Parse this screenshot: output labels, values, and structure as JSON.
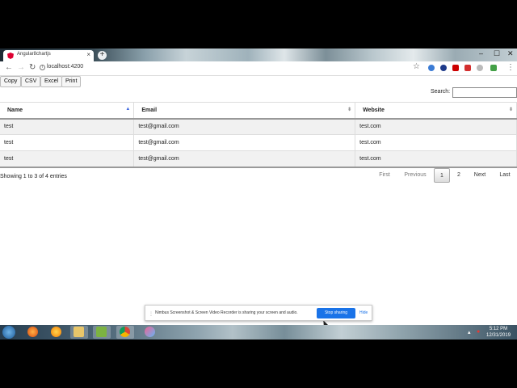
{
  "browser": {
    "tab_title": "Angular8chartjs",
    "tab_close": "×",
    "new_tab": "+",
    "url": "localhost:4200",
    "window_minimize": "–",
    "window_maximize": "☐",
    "window_close": "✕"
  },
  "toolbar": {
    "buttons": [
      "Copy",
      "CSV",
      "Excel",
      "Print"
    ],
    "search_label": "Search:",
    "search_value": ""
  },
  "table": {
    "headers": [
      "Name",
      "Email",
      "Website"
    ],
    "rows": [
      [
        "test",
        "test@gmail.com",
        "test.com"
      ],
      [
        "test",
        "test@gmail.com",
        "test.com"
      ],
      [
        "test",
        "test@gmail.com",
        "test.com"
      ]
    ]
  },
  "footer": {
    "info": "Showing 1 to 3 of 4 entries",
    "pager": {
      "first": "First",
      "previous": "Previous",
      "page1": "1",
      "page2": "2",
      "next": "Next",
      "last": "Last"
    }
  },
  "share_bar": {
    "dots": "⋮",
    "text": "Nimbus Screenshot & Screen Video Recorder is sharing your screen and audio.",
    "stop_label": "Stop sharing",
    "hide_label": "Hide"
  },
  "taskbar": {
    "time": "5:12 PM",
    "date": "12/31/2019"
  },
  "colors": {
    "angular_red": "#dd0031",
    "share_blue": "#1a73e8",
    "sort_active": "#4169e1"
  }
}
